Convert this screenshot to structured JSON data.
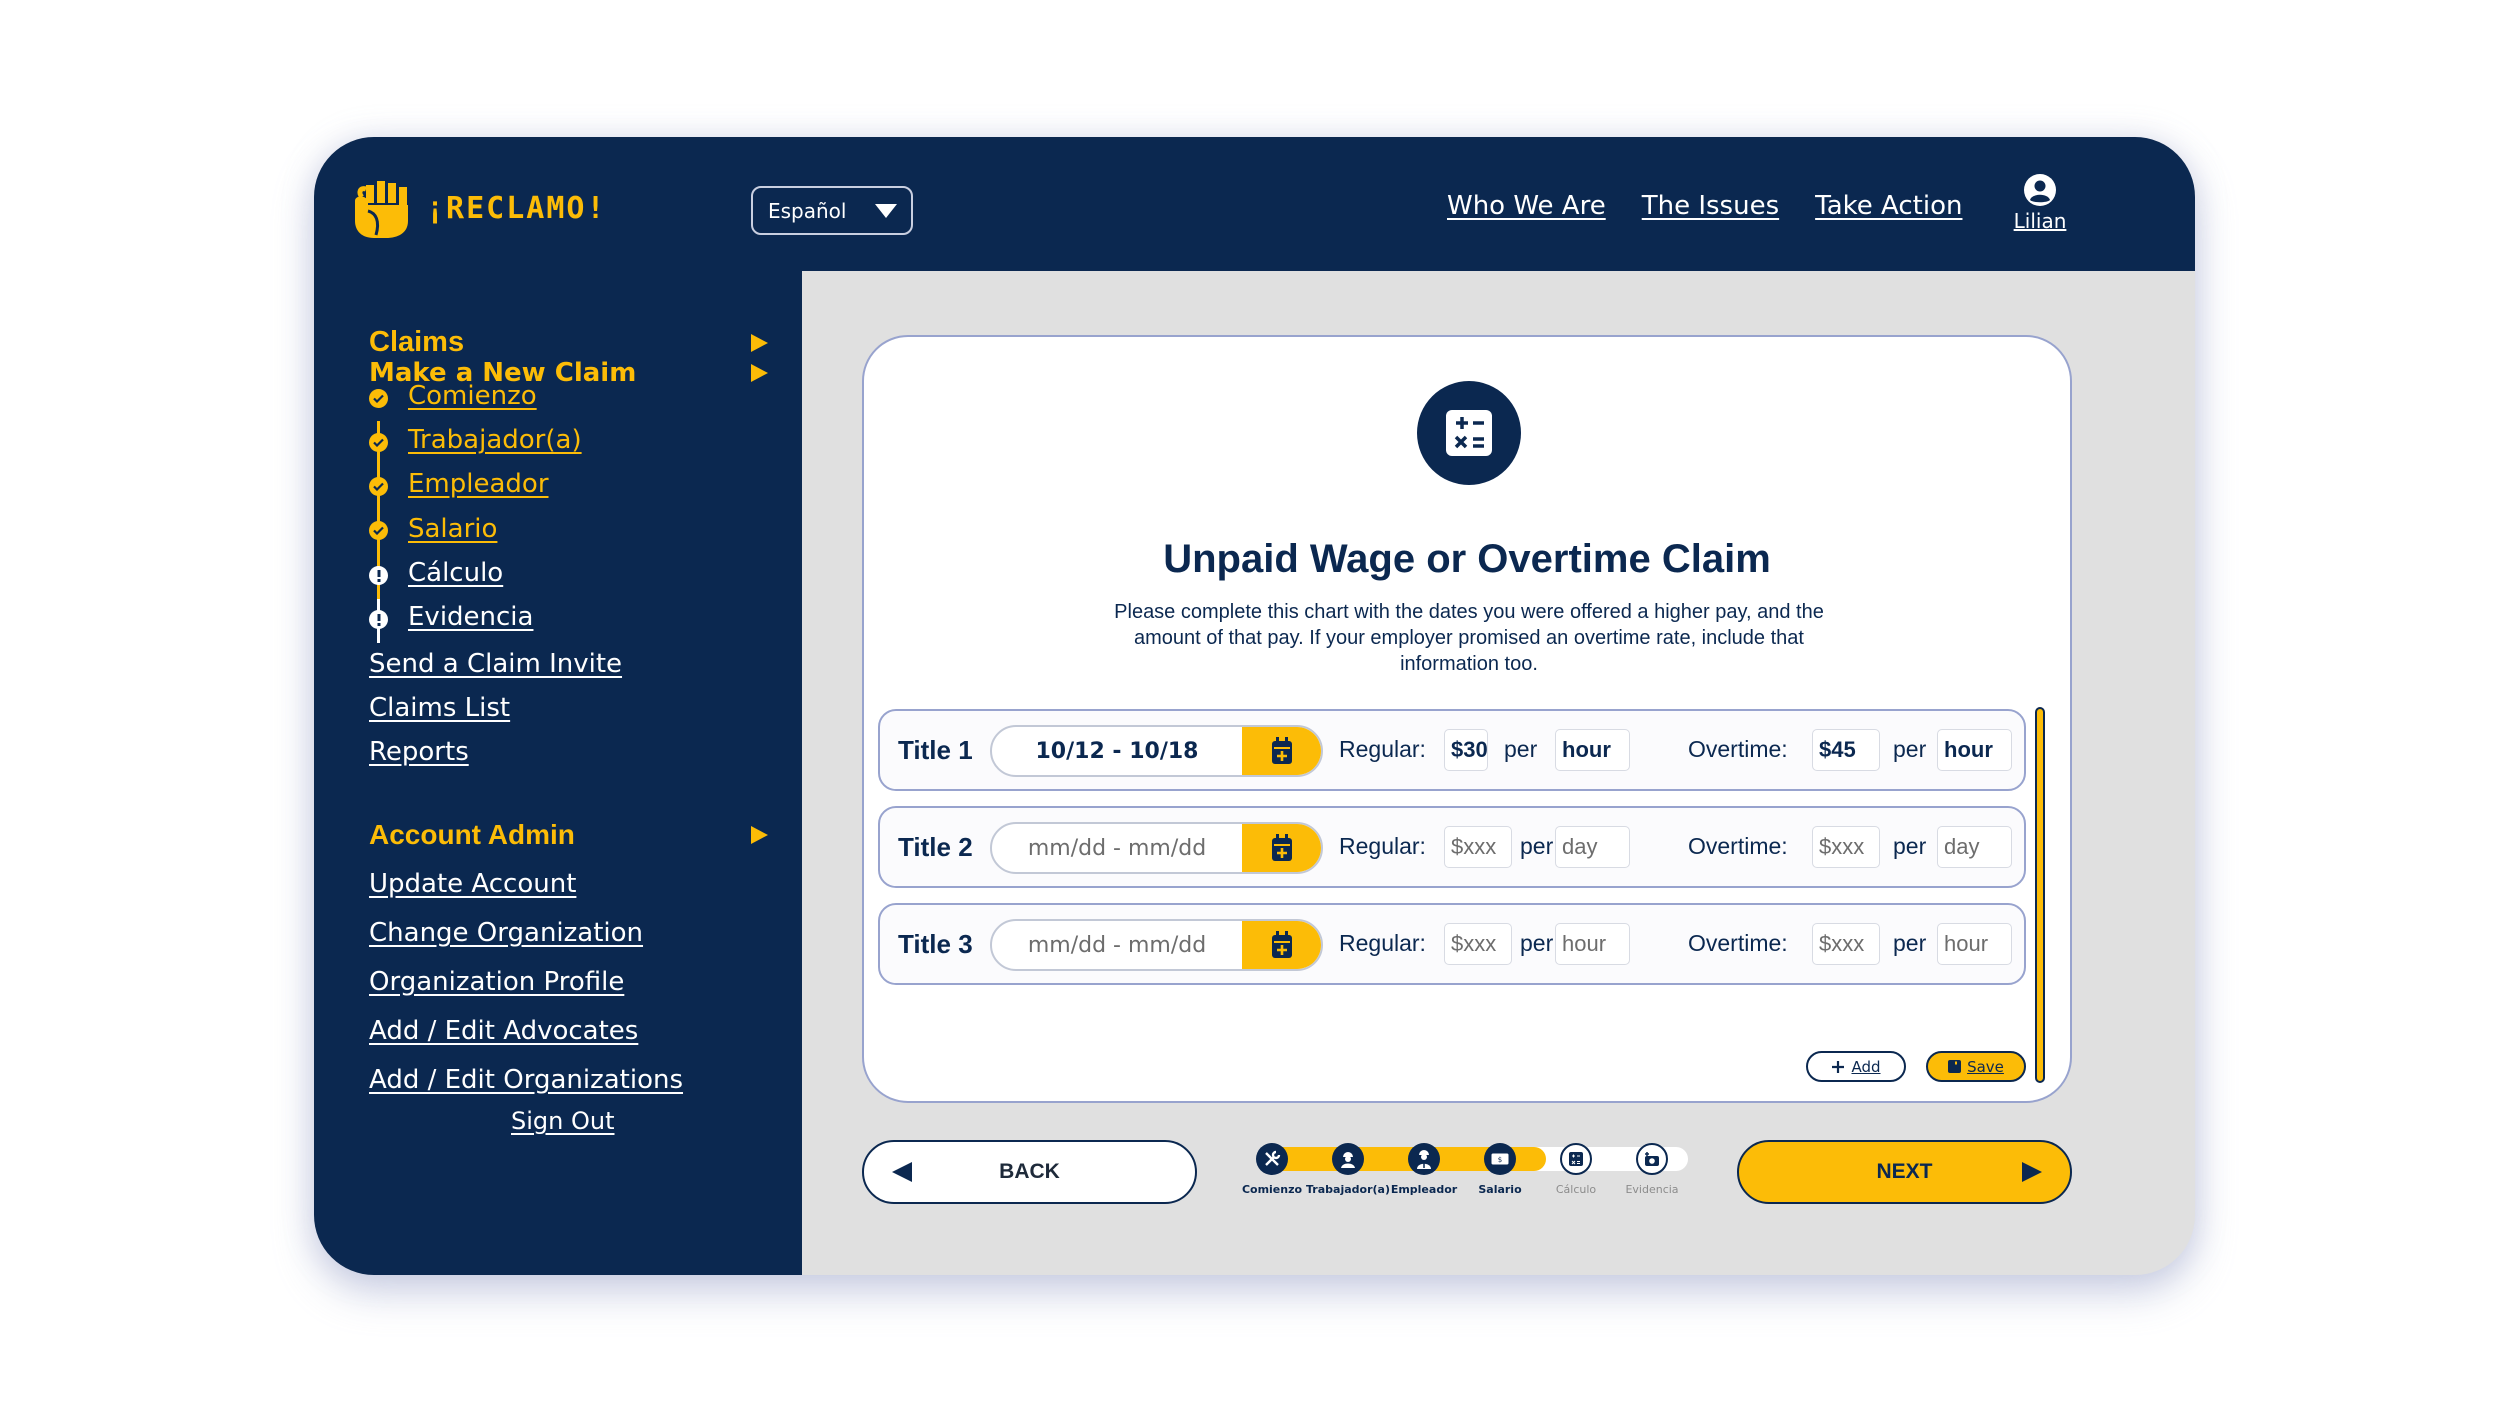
{
  "header": {
    "logo_text": "¡RECLAMO!",
    "language": "Español",
    "nav": [
      "Who We Are",
      "The Issues",
      "Take Action"
    ],
    "user_name": "Lilian"
  },
  "sidebar": {
    "claims_heading": "Claims",
    "new_claim_heading": "Make a New Claim",
    "steps": [
      {
        "label": "Comienzo",
        "status": "done"
      },
      {
        "label": "Trabajador(a)",
        "status": "done"
      },
      {
        "label": "Empleador",
        "status": "done"
      },
      {
        "label": "Salario",
        "status": "done"
      },
      {
        "label": "Cálculo",
        "status": "incomplete"
      },
      {
        "label": "Evidencia",
        "status": "incomplete"
      }
    ],
    "claim_links": [
      "Send a Claim Invite",
      "Claims List",
      "Reports"
    ],
    "admin_heading": "Account Admin",
    "admin_links": [
      "Update Account",
      "Change Organization",
      "Organization Profile",
      "Add / Edit Advocates",
      "Add / Edit Organizations"
    ],
    "sign_out": "Sign Out"
  },
  "card": {
    "icon": "calculator-icon",
    "title": "Unpaid Wage or Overtime Claim",
    "description": "Please complete this chart with the dates you were offered a higher pay, and the amount of that pay. If your employer promised an overtime rate, include that information too.",
    "regular_label": "Regular:",
    "overtime_label": "Overtime:",
    "per_label": "per",
    "rows": [
      {
        "title": "Title 1",
        "dates": "10/12 - 10/18",
        "dates_placeholder": "mm/dd - mm/dd",
        "dates_filled": true,
        "regular": "$30",
        "regular_filled": true,
        "regular_unit": "hour",
        "regular_unit_filled": true,
        "overtime": "$45",
        "overtime_filled": true,
        "overtime_unit": "hour",
        "overtime_unit_filled": true
      },
      {
        "title": "Title 2",
        "dates": "mm/dd - mm/dd",
        "dates_filled": false,
        "regular": "$xxx",
        "regular_filled": false,
        "regular_unit": "day",
        "regular_unit_filled": false,
        "overtime": "$xxx",
        "overtime_filled": false,
        "overtime_unit": "day",
        "overtime_unit_filled": false
      },
      {
        "title": "Title 3",
        "dates": "mm/dd - mm/dd",
        "dates_filled": false,
        "regular": "$xxx",
        "regular_filled": false,
        "regular_unit": "hour",
        "regular_unit_filled": false,
        "overtime": "$xxx",
        "overtime_filled": false,
        "overtime_unit": "hour",
        "overtime_unit_filled": false
      }
    ],
    "add_label": "Add",
    "save_label": "Save"
  },
  "footer": {
    "back_label": "BACK",
    "next_label": "NEXT",
    "progress": {
      "completed_fraction": 0.667,
      "steps": [
        {
          "label": "Comienzo",
          "icon": "tools-icon",
          "status": "done"
        },
        {
          "label": "Trabajador(a)",
          "icon": "worker-icon",
          "status": "done"
        },
        {
          "label": "Empleador",
          "icon": "employer-icon",
          "status": "done"
        },
        {
          "label": "Salario",
          "icon": "money-icon",
          "status": "done"
        },
        {
          "label": "Cálculo",
          "icon": "calculator-icon",
          "status": "todo"
        },
        {
          "label": "Evidencia",
          "icon": "camera-icon",
          "status": "todo"
        }
      ]
    }
  },
  "colors": {
    "navy": "#0B2850",
    "gold": "#FCBC07",
    "content_bg": "#E0E0E0",
    "card_border": "#98A3CE"
  }
}
